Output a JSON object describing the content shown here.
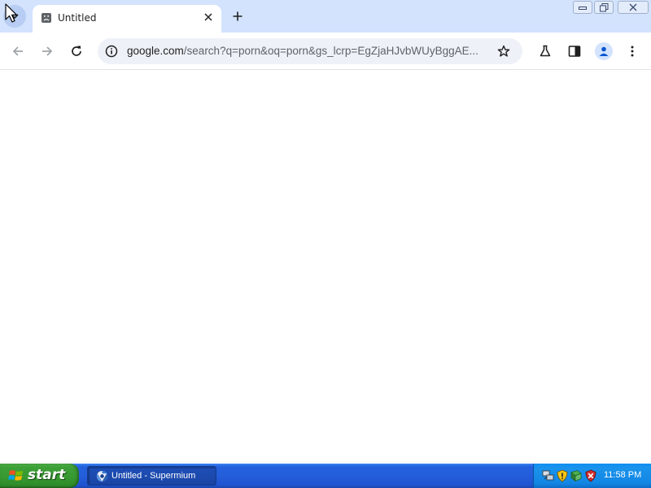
{
  "browser": {
    "tab": {
      "title": "Untitled",
      "favicon": "sad-page-icon",
      "close": "close-icon"
    },
    "new_tab": "plus-icon",
    "toolbar": {
      "back": "arrow-left-icon",
      "forward": "arrow-right-icon",
      "reload": "reload-icon",
      "labs": "flask-icon",
      "side_panel": "side-panel-icon",
      "profile": "person-icon",
      "menu": "kebab-menu-icon"
    },
    "omnibox": {
      "host": "google.com",
      "path": "/search?q=porn&oq=porn&gs_lcrp=EgZjaHJvbWUyBggAE...",
      "info_icon": "info-icon",
      "bookmark_icon": "star-icon"
    },
    "colors": {
      "tabstrip": "#d3e3fd",
      "omnibox": "#eef2f8"
    }
  },
  "taskbar": {
    "start_label": "start",
    "task_item": "Untitled - Supermium",
    "tray_icons": [
      "network-icon",
      "security-shield-icon",
      "update-icon",
      "antivirus-shield-icon"
    ],
    "clock": "11:58 PM",
    "colors": {
      "taskbar": "#245edb",
      "start": "#379a31",
      "tray": "#1286e3"
    }
  }
}
